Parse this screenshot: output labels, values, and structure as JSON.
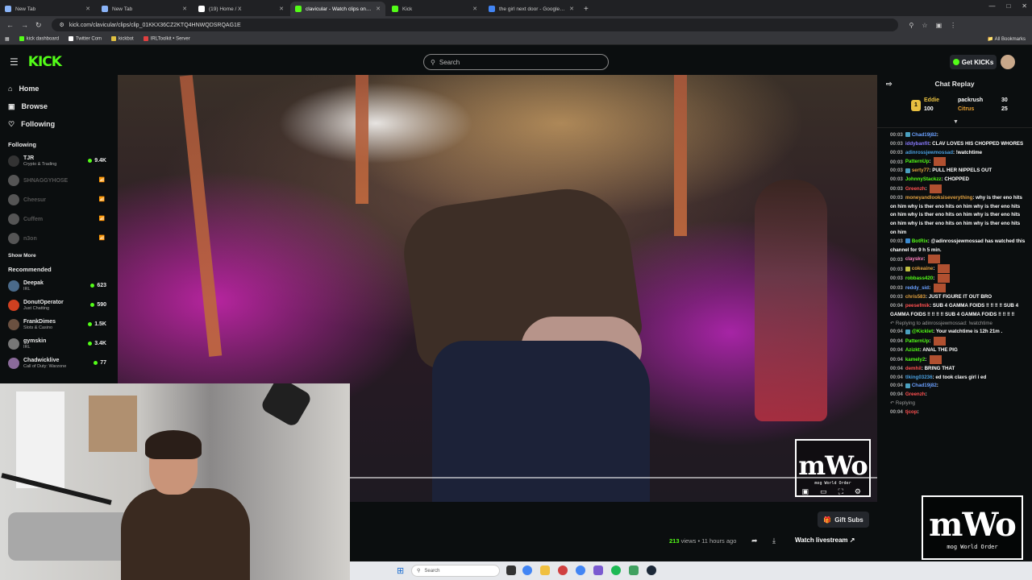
{
  "tabs": [
    {
      "label": "New Tab",
      "color": "#8ab4f8",
      "active": false
    },
    {
      "label": "New Tab",
      "color": "#8ab4f8",
      "active": false
    },
    {
      "label": "(19) Home / X",
      "color": "#ffffff",
      "active": false
    },
    {
      "label": "clavicular - Watch clips on Kick",
      "color": "#53fc18",
      "active": true
    },
    {
      "label": "Kick",
      "color": "#53fc18",
      "active": false
    },
    {
      "label": "the girl next door - Google Sea",
      "color": "#4285f4",
      "active": false
    }
  ],
  "url": "kick.com/clavicular/clips/clip_01KKX36CZ2KTQ4HNWQDSRQAG1E",
  "bookmarks": [
    "kick dashboard",
    "Twitter Com",
    "kickbot",
    "IRLToolkit • Server"
  ],
  "all_bookmarks": "All Bookmarks",
  "search_placeholder": "Search",
  "get_kicks": "Get KICKs",
  "nav": {
    "home": "Home",
    "browse": "Browse",
    "following": "Following"
  },
  "following_heading": "Following",
  "following": [
    {
      "name": "TJR",
      "sub": "Crypto & Trading",
      "viewers": "9.4K",
      "color": "#333",
      "online": true
    },
    {
      "name": "SHNAGGYHOSE",
      "sub": "",
      "viewers": "",
      "color": "#555",
      "online": false
    },
    {
      "name": "Cheesur",
      "sub": "",
      "viewers": "",
      "color": "#555",
      "online": false
    },
    {
      "name": "Cuffem",
      "sub": "",
      "viewers": "",
      "color": "#555",
      "online": false
    },
    {
      "name": "n3on",
      "sub": "",
      "viewers": "",
      "color": "#555",
      "online": false
    }
  ],
  "show_more": "Show More",
  "recommended_heading": "Recommended",
  "recommended": [
    {
      "name": "Deepak",
      "sub": "IRL",
      "viewers": "623",
      "color": "#4a6a8a"
    },
    {
      "name": "DonutOperator",
      "sub": "Just Chatting",
      "viewers": "590",
      "color": "#d04020"
    },
    {
      "name": "FrankDimes",
      "sub": "Slots & Casino",
      "viewers": "1.5K",
      "color": "#6a5040"
    },
    {
      "name": "gymskin",
      "sub": "IRL",
      "viewers": "3.4K",
      "color": "#777"
    },
    {
      "name": "Chadwicklive",
      "sub": "Call of Duty: Warzone",
      "viewers": "77",
      "color": "#8a6a9a"
    }
  ],
  "video": {
    "logo_big": "mWo",
    "logo_small": "mog World Order"
  },
  "overlay": {
    "logo_big": "mWo",
    "logo_small": "mog World Order"
  },
  "clip": {
    "gift_subs": "Gift Subs",
    "views": "213",
    "views_label": "views",
    "ago": "11 hours ago",
    "watch_livestream": "Watch livestream"
  },
  "chat": {
    "title": "Chat Replay",
    "leaderboard": [
      {
        "name": "Eddie",
        "amount": "100",
        "rank": "1",
        "color": "#e8c040"
      },
      {
        "name": "packrush",
        "amount": "30",
        "rank": "",
        "color": "#ffffff"
      },
      {
        "name": "Citrus",
        "amount": "25",
        "rank": "",
        "color": "#e8a030"
      }
    ],
    "messages": [
      {
        "time": "00:03",
        "user": "Chad19j82",
        "color": "#6aa0ff",
        "text": "",
        "badge": "#4aa0c0",
        "emote": false
      },
      {
        "time": "00:03",
        "user": "iddybanfit",
        "color": "#8a7aff",
        "text": "CLAV LOVES HIS CHOPPED WHORES",
        "badge": "",
        "emote": false
      },
      {
        "time": "00:03",
        "user": "adinrossjewmossad",
        "color": "#4aa0e0",
        "text": "!watchtime",
        "badge": "",
        "emote": false
      },
      {
        "time": "00:03",
        "user": "PatternUp",
        "color": "#53fc18",
        "text": "",
        "badge": "",
        "emote": true
      },
      {
        "time": "00:03",
        "user": "serty77",
        "color": "#e0a040",
        "text": "PULL HER NIPPELS OUT",
        "badge": "#4aa0c0",
        "emote": false
      },
      {
        "time": "00:03",
        "user": "JohnnyStackzz",
        "color": "#53fc18",
        "text": "CHOPPED",
        "badge": "",
        "emote": false
      },
      {
        "time": "00:03",
        "user": "Greenzh",
        "color": "#ff5050",
        "text": "",
        "badge": "",
        "emote": true
      },
      {
        "time": "00:03",
        "user": "moneyandlooksiseverything",
        "color": "#e0a040",
        "text": "why is ther eno hits on him why is ther eno hits on him why is ther eno hits on him why is ther eno hits on him why is ther eno hits on him why is ther eno hits on him why is ther eno hits on him",
        "badge": "",
        "emote": false
      },
      {
        "time": "00:03",
        "user": "BotRix",
        "color": "#53fc18",
        "text": "@adinrossjewmossad has watched this channel for 9 h 5 min.",
        "badge": "#3a8ad0",
        "emote": false
      },
      {
        "time": "00:03",
        "user": "clayskv",
        "color": "#ff80c0",
        "text": "",
        "badge": "",
        "emote": true
      },
      {
        "time": "00:03",
        "user": "cokeaine",
        "color": "#e0a040",
        "text": "",
        "badge": "#c0c040",
        "emote": true
      },
      {
        "time": "00:03",
        "user": "robbass420",
        "color": "#53fc18",
        "text": "",
        "badge": "",
        "emote": true
      },
      {
        "time": "00:03",
        "user": "reddy_sid",
        "color": "#6aa0ff",
        "text": "",
        "badge": "",
        "emote": true
      },
      {
        "time": "00:03",
        "user": "chris583",
        "color": "#e0a040",
        "text": "JUST FIGURE IT OUT BRO",
        "badge": "",
        "emote": false
      },
      {
        "time": "00:04",
        "user": "peesefmik",
        "color": "#ff5050",
        "text": "SUB 4 GAMMA FOIDS ‼ ‼ ‼ ‼ SUB 4 GAMMA FOIDS ‼ ‼ ‼ ‼ SUB 4 GAMMA FOIDS ‼ ‼ ‼ ‼",
        "badge": "",
        "emote": false
      },
      {
        "time": "",
        "user": "",
        "color": "#999",
        "text": "Replying to adinrossjewmossad: !watchtime",
        "badge": "",
        "emote": false
      },
      {
        "time": "00:04",
        "user": "@Kicklet",
        "color": "#53fc18",
        "text": "Your watchtime is 12h 21m .",
        "badge": "#4aa0c0",
        "emote": false
      },
      {
        "time": "00:04",
        "user": "PatternUp",
        "color": "#53fc18",
        "text": "",
        "badge": "",
        "emote": true
      },
      {
        "time": "00:04",
        "user": "Azizkt",
        "color": "#53fc18",
        "text": "ANAL THE PIG",
        "badge": "",
        "emote": false
      },
      {
        "time": "00:04",
        "user": "kamely2",
        "color": "#53fc18",
        "text": "",
        "badge": "",
        "emote": true
      },
      {
        "time": "00:04",
        "user": "demhil",
        "color": "#ff5050",
        "text": "BRING THAT",
        "badge": "",
        "emote": false
      },
      {
        "time": "00:04",
        "user": "tlking03236",
        "color": "#4aa0e0",
        "text": "ed took clavs girl i ed",
        "badge": "",
        "emote": false
      },
      {
        "time": "00:04",
        "user": "Chad19j82",
        "color": "#6aa0ff",
        "text": "",
        "badge": "#4aa0c0",
        "emote": false
      },
      {
        "time": "00:04",
        "user": "Greenzh",
        "color": "#ff5050",
        "text": "",
        "badge": "",
        "emote": false
      },
      {
        "time": "",
        "user": "",
        "color": "#999",
        "text": "Replying",
        "badge": "",
        "emote": false
      },
      {
        "time": "00:04",
        "user": "tjcop",
        "color": "#ff5050",
        "text": "",
        "badge": "",
        "emote": false
      }
    ]
  },
  "taskbar": {
    "search": "Search"
  }
}
